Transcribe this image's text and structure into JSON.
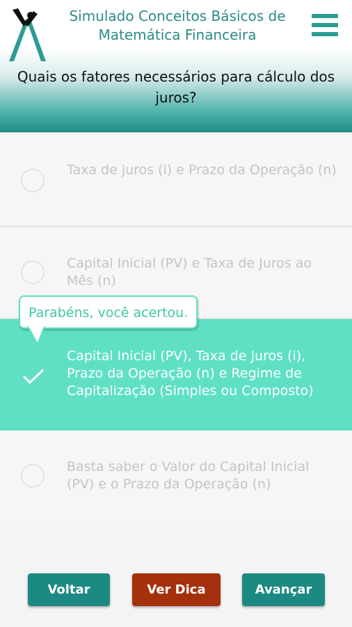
{
  "header": {
    "title": "Simulado Conceitos Básicos de Matemática Financeira",
    "logo_icon": "scale-logo-icon",
    "menu_icon": "hamburger-menu-icon"
  },
  "question": "Quais os fatores necessários para cálculo dos juros?",
  "options": [
    {
      "text": "Taxa de juros (i) e Prazo da Operação (n)",
      "selected": false
    },
    {
      "text": "Capital Inicial (PV) e Taxa de Juros ao Mês (n)",
      "selected": false
    },
    {
      "text": "Capital Inicial (PV), Taxa de Juros (i), Prazo da Operação (n) e Regime de Capitalização (Simples ou Composto)",
      "selected": true
    },
    {
      "text": "Basta saber o Valor do Capital Inicial (PV) e o Prazo da Operação (n)",
      "selected": false
    }
  ],
  "feedback": "Parabéns, você acertou.",
  "buttons": {
    "back": "Voltar",
    "hint": "Ver Dica",
    "next": "Avançar"
  },
  "colors": {
    "accent": "#1c8a82",
    "correct": "#5fe0c4",
    "hint": "#a4300d"
  }
}
